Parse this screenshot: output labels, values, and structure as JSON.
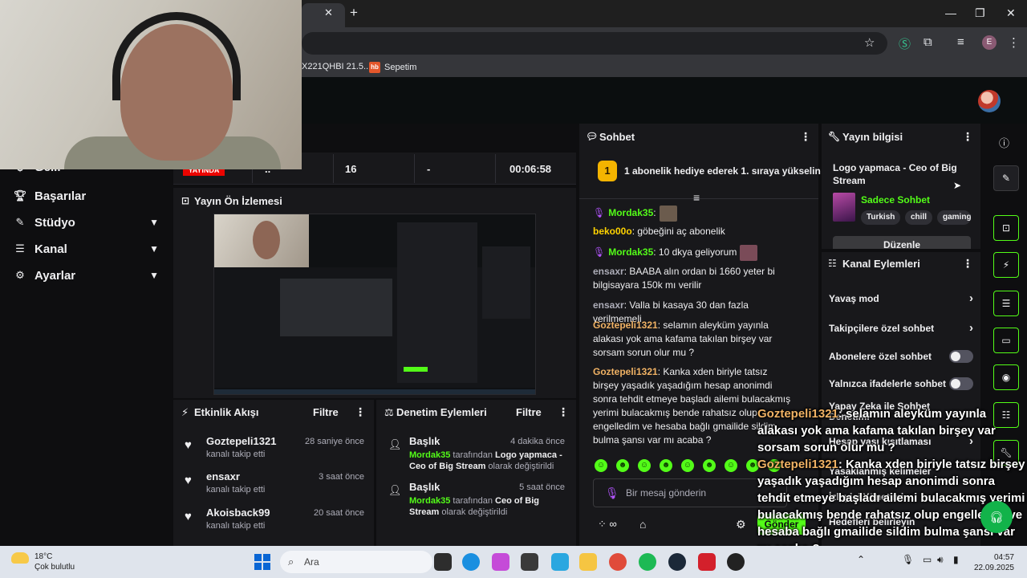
{
  "browser": {
    "bookmark_text": "X221QHBI 21.5...",
    "bookmark_icon": "hb",
    "bookmark_label": "Sepetim",
    "profile_initial": "E"
  },
  "stats": {
    "live": "YAYINDA",
    "followers": "..",
    "viewers": "16",
    "dash": "-",
    "uptime": "00:06:58"
  },
  "nav": {
    "partial": "Gelir",
    "items": [
      {
        "label": "Başarılar"
      },
      {
        "label": "Stüdyo"
      },
      {
        "label": "Kanal"
      },
      {
        "label": "Ayarlar"
      }
    ]
  },
  "preview": {
    "title": "Yayın Ön İzlemesi"
  },
  "activity": {
    "title": "Etkinlik Akışı",
    "filter": "Filtre",
    "items": [
      {
        "user": "Goztepeli1321",
        "time": "28 saniye önce",
        "action": "kanalı takip etti"
      },
      {
        "user": "ensaxr",
        "time": "3 saat önce",
        "action": "kanalı takip etti"
      },
      {
        "user": "Akoisback99",
        "time": "20 saat önce",
        "action": "kanalı takip etti"
      }
    ]
  },
  "moderation": {
    "title": "Denetim Eylemleri",
    "filter": "Filtre",
    "items": [
      {
        "head": "Başlık",
        "time": "4 dakika önce",
        "user": "Mordak35",
        "mid": " tarafından ",
        "value": "Logo yapmaca - Ceo of Big Stream",
        "tail": " olarak değiştirildi"
      },
      {
        "head": "Başlık",
        "time": "5 saat önce",
        "user": "Mordak35",
        "mid": " tarafından ",
        "value": "Ceo of Big Stream",
        "tail": " olarak değiştirildi"
      }
    ]
  },
  "chat": {
    "title": "Sohbet",
    "gift_rank": "1",
    "gift_text": "1 abonelik hediye ederek 1. sıraya yükselin",
    "messages": [
      {
        "user": "Mordak35",
        "text": ":",
        "color": "#53fc18"
      },
      {
        "user": "beko00o",
        "text": ": göbeğini aç abonelik",
        "color": "#ffd300"
      },
      {
        "user": "Mordak35",
        "text": ": 10 dkya geliyorum",
        "color": "#53fc18"
      },
      {
        "user": "ensaxr",
        "text": ": BAABA alın ordan bi 1660 yeter bi bilgisayara 150k mı verilir",
        "color": "#adadb8"
      },
      {
        "user": "ensaxr",
        "text": ": Valla bi kasaya 30 dan fazla verilmemeli",
        "color": "#adadb8"
      },
      {
        "user": "Goztepeli1321",
        "text": ": selamın aleyküm yayınla alakası yok ama kafama takılan birşey var sorsam sorun olur mu ?",
        "color": "#f0b264"
      },
      {
        "user": "Goztepeli1321",
        "text": ": Kanka xden biriyle tatsız birşey yaşadık yaşadığım hesap anonimdi sonra tehdit etmeye başladı ailemi bulacakmış yerimi bulacakmış bende rahatsız olup engelledim ve hesaba bağlı gmailide sildim bulma şansı var mı acaba ?",
        "color": "#f0b264"
      }
    ],
    "input_placeholder": "Bir mesaj gönderin",
    "send_label": "Gönder"
  },
  "stream_info": {
    "title": "Yayın bilgisi",
    "stream_title": "Logo yapmaca - Ceo of Big Stream",
    "category": "Sadece Sohbet",
    "category_art": "JUST CHATTING",
    "tags": [
      "Turkish",
      "chill",
      "gaming"
    ],
    "edit": "Düzenle"
  },
  "channel_actions": {
    "title": "Kanal Eylemleri",
    "rows": [
      {
        "label": "Yavaş mod"
      },
      {
        "label": "Takipçilere özel sohbet"
      },
      {
        "label": "Abonelere özel sohbet"
      },
      {
        "label": "Yalnızca ifadelerle sohbet"
      },
      {
        "label": "Yapay Zeka ile Sohbet Denetimi"
      },
      {
        "label": "Hesap yaşı kısıtlaması"
      },
      {
        "label": "Yasaklanmış kelimeler"
      },
      {
        "label": "İzleyici Yönetimi"
      },
      {
        "label": "Hedefleri belirleyin"
      }
    ]
  },
  "overlay": {
    "line1_user": "Goztepeli1321",
    "line1_text": ": selamın aleyküm yayınla alakası yok ama kafama takılan birşey var sorsam sorun olur mu ?",
    "line2_user": "Goztepeli1321",
    "line2_text": ": Kanka xden biriyle tatsız birşey yaşadık yaşadığım hesap anonimdi sonra tehdit etmeye başladı ailemi bulacakmış yerimi bulacakmış bende rahatsız olup engelledim ve hesaba bağlı gmailide sildim bulma şansı var mı acaba ?"
  },
  "taskbar": {
    "temp": "18°C",
    "weather": "Çok bulutlu",
    "search": "Ara",
    "time": "04:57",
    "date": "22.09.2025"
  }
}
